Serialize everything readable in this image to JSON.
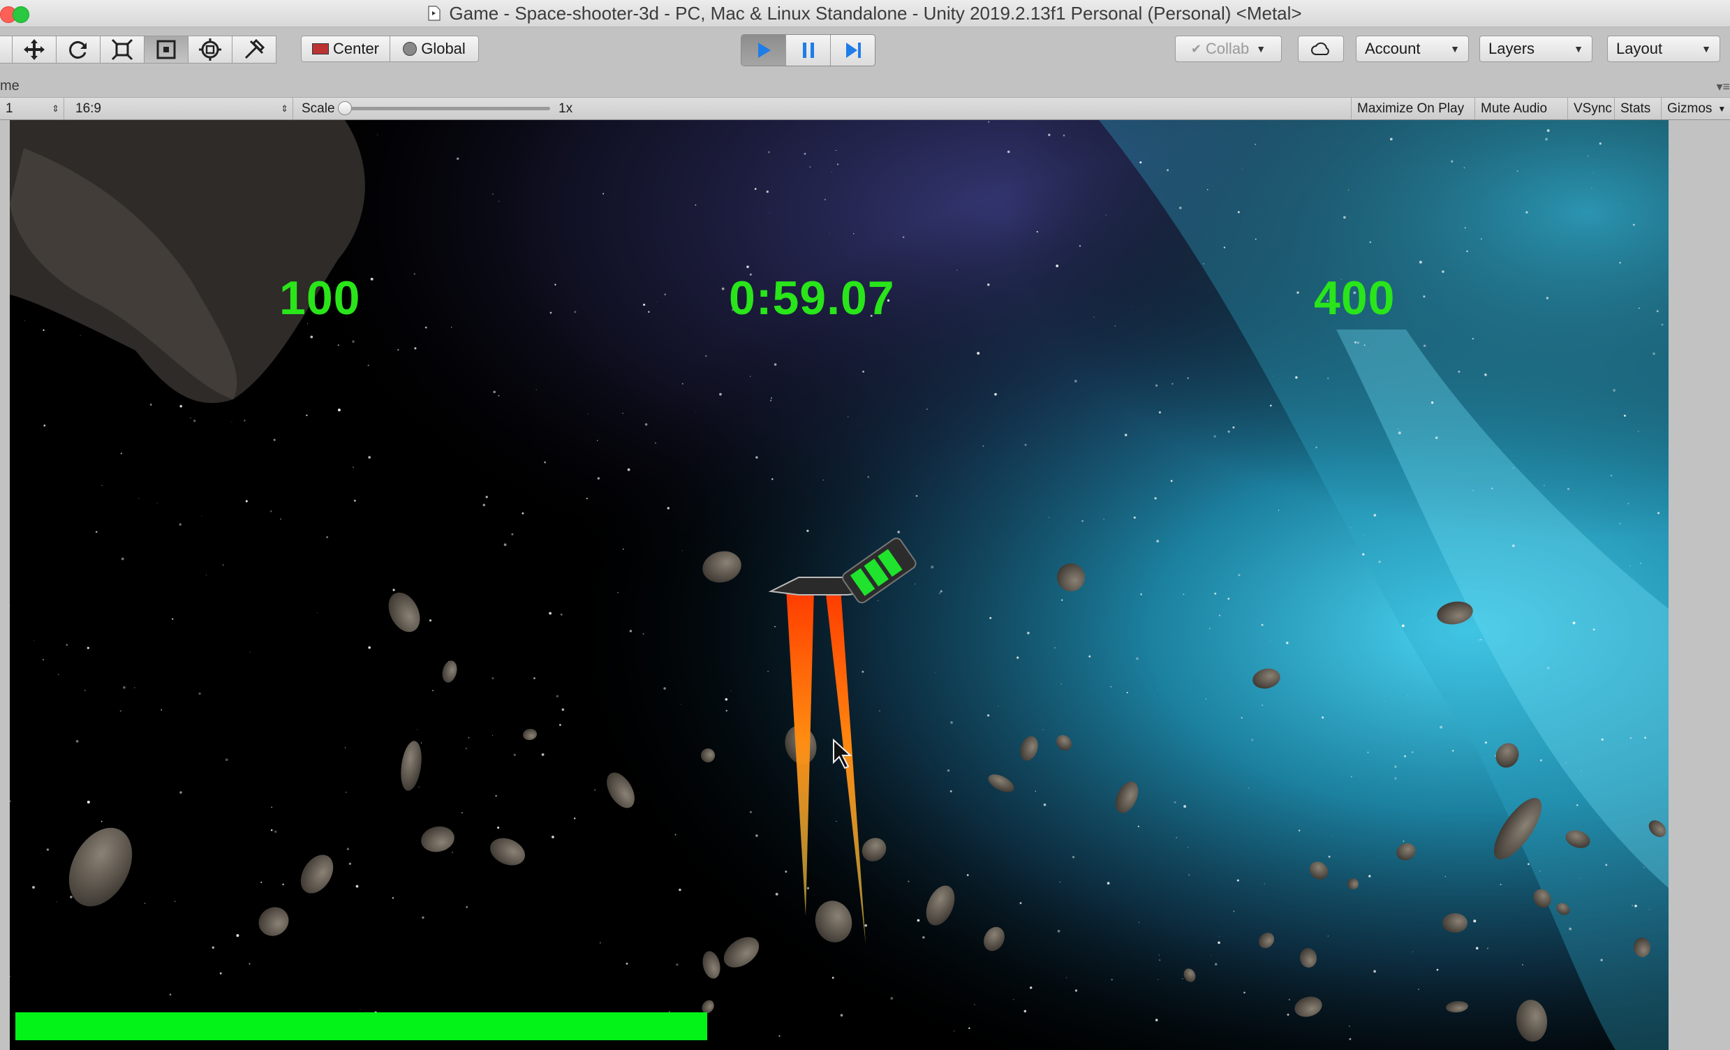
{
  "window": {
    "title": "Game - Space-shooter-3d - PC, Mac & Linux Standalone - Unity 2019.2.13f1 Personal (Personal) <Metal>"
  },
  "toolbar": {
    "tools": [
      "hand-tool-icon",
      "move-tool-icon",
      "rotate-tool-icon",
      "scale-tool-icon",
      "rect-tool-icon",
      "transform-tool-icon",
      "custom-tool-icon"
    ],
    "pivot_label": "Center",
    "space_label": "Global",
    "collab_label": "Collab",
    "account_label": "Account",
    "layers_label": "Layers",
    "layout_label": "Layout"
  },
  "tab": {
    "label": "me"
  },
  "viewbar": {
    "display": "1",
    "aspect": "16:9",
    "scale_label": "Scale",
    "scale_value": "1x",
    "scale_fraction": 0.0,
    "maximize": "Maximize On Play",
    "mute": "Mute Audio",
    "vsync": "VSync",
    "stats": "Stats",
    "gizmos": "Gizmos"
  },
  "hud": {
    "left_value": "100",
    "timer": "0:59.07",
    "right_value": "400",
    "text_color": "#29e51a",
    "health_fraction": 0.42,
    "health_color": "#03f217"
  }
}
